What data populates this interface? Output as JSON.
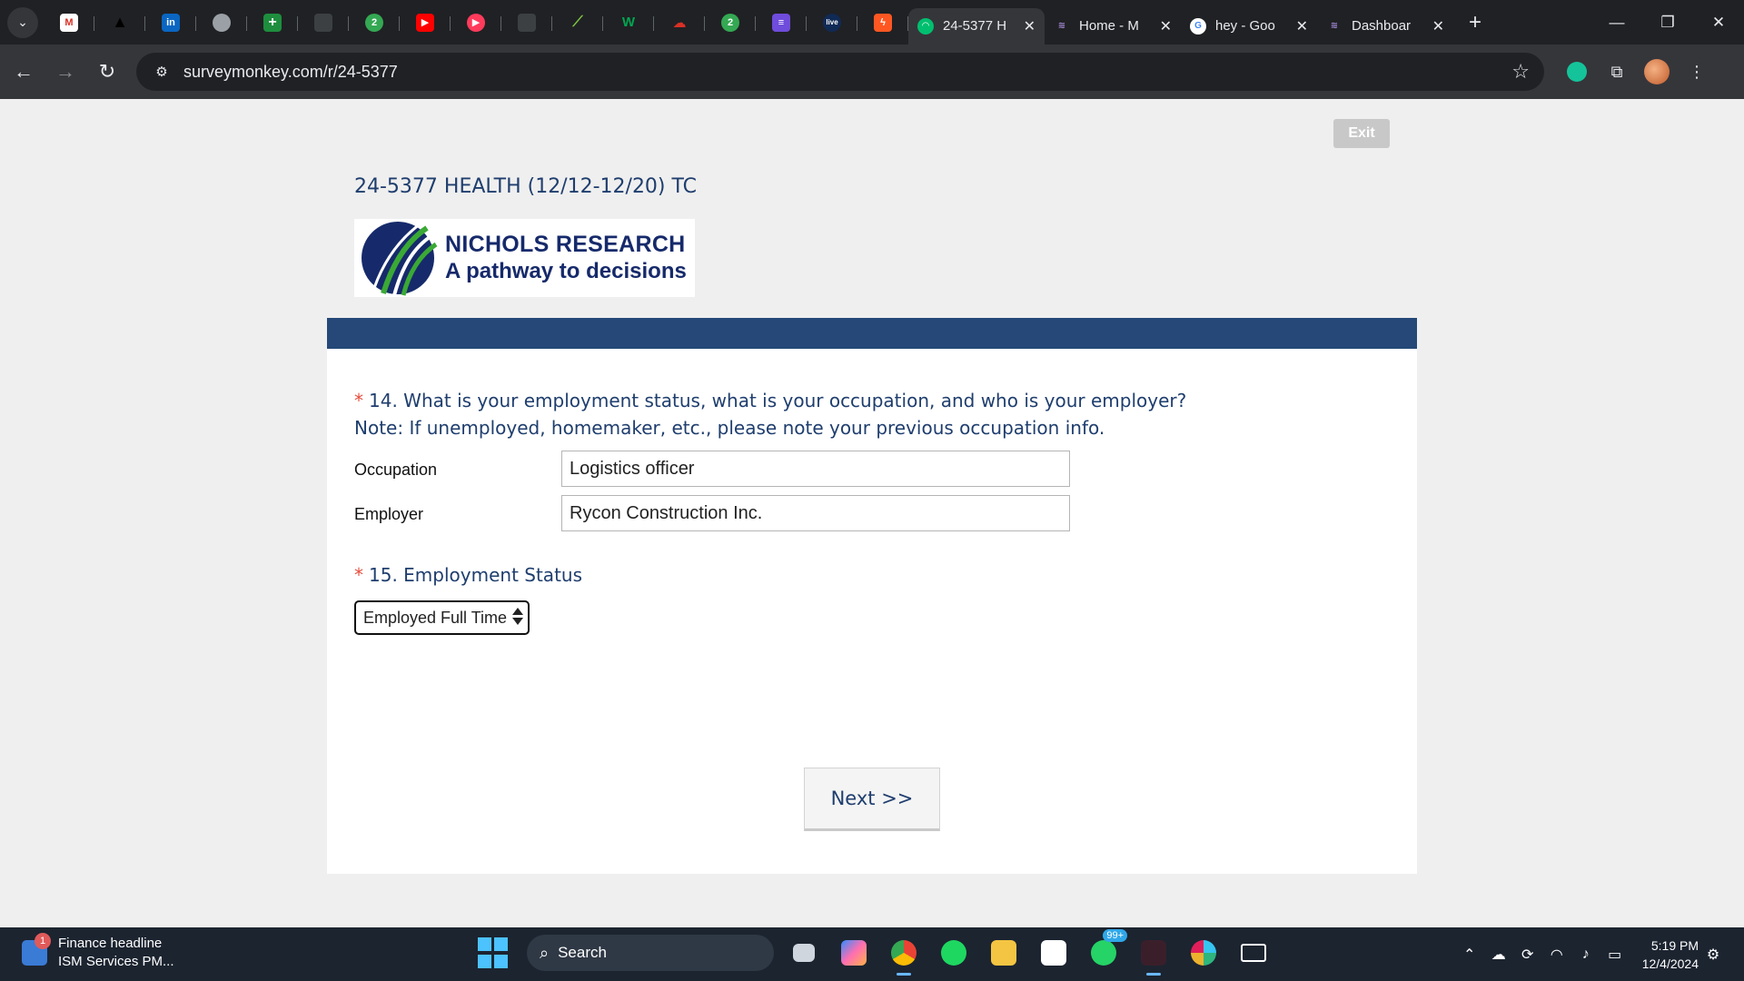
{
  "browser": {
    "tabs": [
      {
        "title": "24-5377 H",
        "active": true
      },
      {
        "title": "Home - M",
        "active": false
      },
      {
        "title": "hey - Goo",
        "active": false
      },
      {
        "title": "Dashboar",
        "active": false
      }
    ],
    "url": "surveymonkey.com/r/24-5377"
  },
  "survey": {
    "exit_label": "Exit",
    "title": "24-5377 HEALTH (12/12-12/20) TC",
    "logo_line1": "NICHOLS RESEARCH",
    "logo_line2": "A pathway to decisions",
    "q14": {
      "required_mark": "*",
      "text": "14. What is your employment status, what is your occupation, and who is your employer?",
      "note": "Note: If unemployed, homemaker, etc., please note your previous occupation info.",
      "occupation_label": "Occupation",
      "occupation_value": "Logistics officer",
      "employer_label": "Employer",
      "employer_value": "Rycon Construction Inc."
    },
    "q15": {
      "required_mark": "*",
      "text": "15. Employment Status",
      "selected": "Employed Full Time"
    },
    "next_label": "Next >>"
  },
  "taskbar": {
    "news_badge": "1",
    "news_title": "Finance headline",
    "news_sub": "ISM Services PM...",
    "search_label": "Search",
    "whatsapp_badge": "99+",
    "time": "5:19 PM",
    "date": "12/4/2024"
  },
  "colors": {
    "survey_blue": "#1f3e6e",
    "banner": "#254878",
    "required": "#e74c3c"
  }
}
